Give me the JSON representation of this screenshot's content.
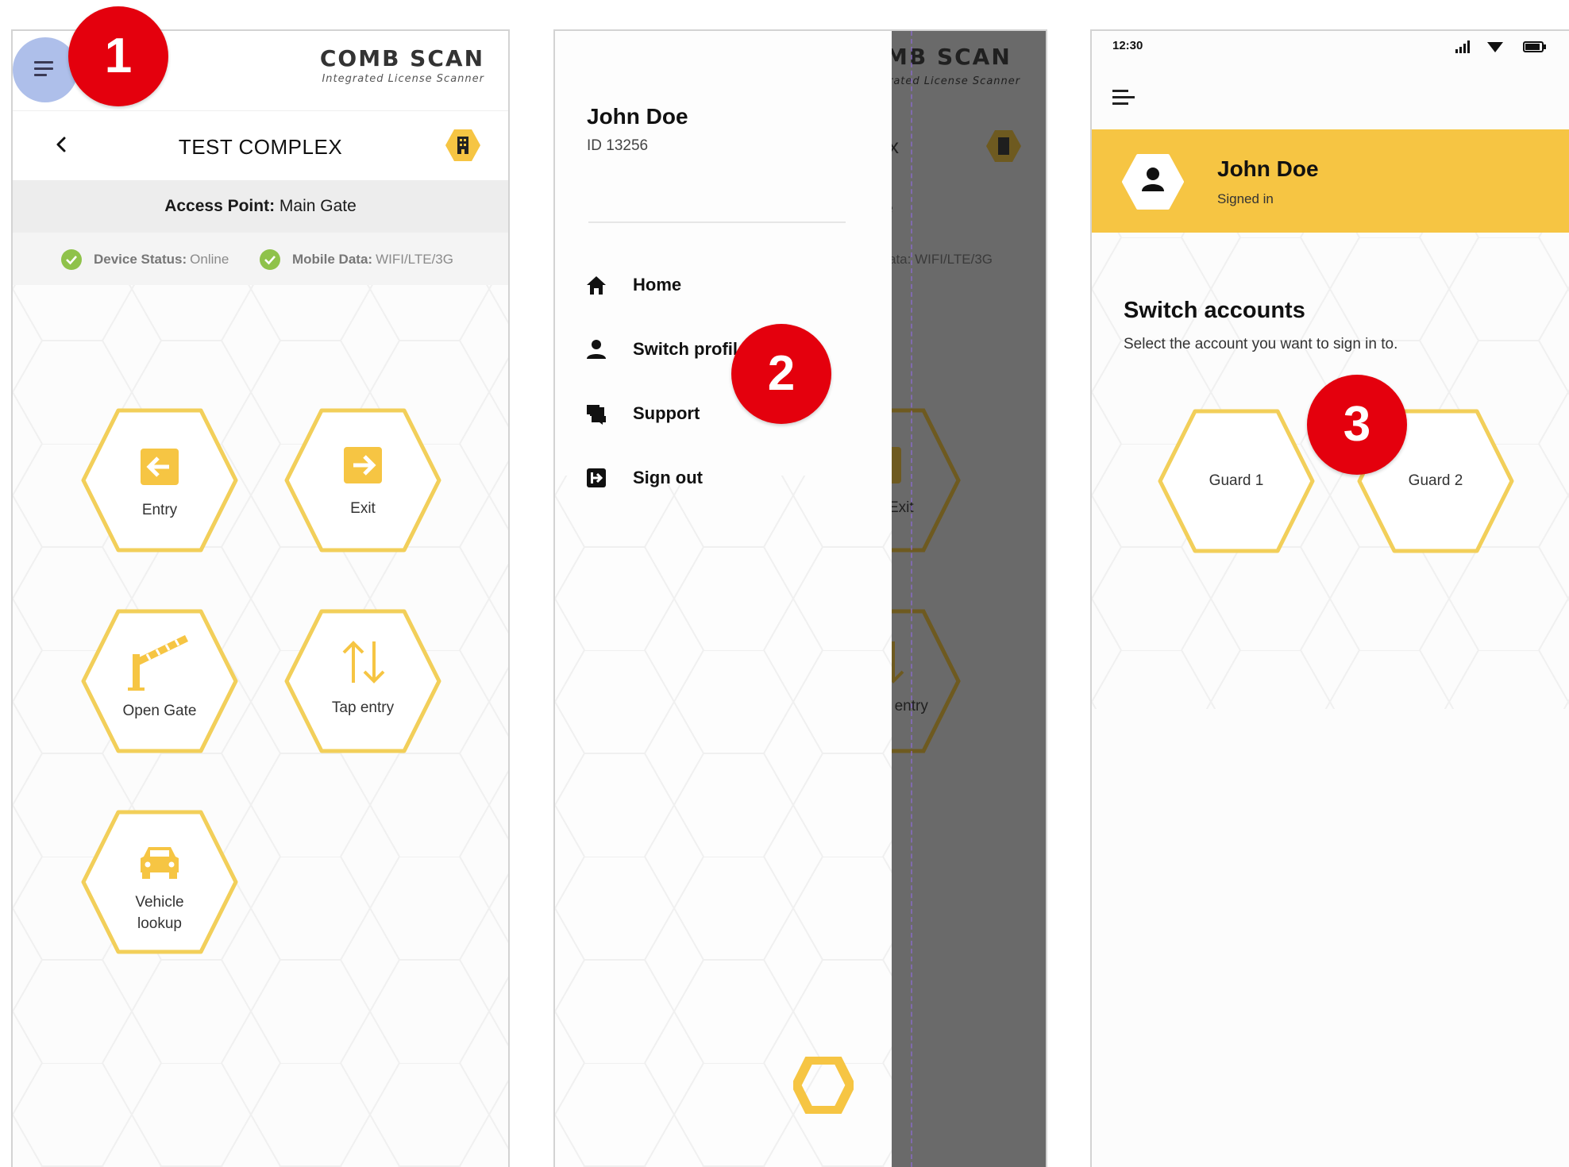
{
  "colors": {
    "accent": "#f6c543",
    "hex_outline": "#f2cf5a",
    "menu_highlight": "#aebfea",
    "marker": "#e4000d",
    "status_ok": "#8fc24a",
    "overlay": "#6a6a6a"
  },
  "logo": {
    "title": "COMB SCAN",
    "subtitle": "Integrated License Scanner"
  },
  "screen1": {
    "menu_icon": "hamburger-icon",
    "title": "TEST COMPLEX",
    "access_point": {
      "label": "Access Point:",
      "value": "Main Gate"
    },
    "status": [
      {
        "label": "Device Status:",
        "value": "Online",
        "icon": "check-circle-icon"
      },
      {
        "label": "Mobile Data:",
        "value": "WIFI/LTE/3G",
        "icon": "check-circle-icon"
      }
    ],
    "actions": [
      {
        "label": "Entry",
        "icon": "entry-arrow-icon"
      },
      {
        "label": "Exit",
        "icon": "exit-arrow-icon"
      },
      {
        "label": "Open Gate",
        "icon": "gate-barrier-icon"
      },
      {
        "label": "Tap entry",
        "icon": "swap-arrows-icon"
      },
      {
        "label_line1": "Vehicle",
        "label_line2": "lookup",
        "icon": "car-icon"
      }
    ]
  },
  "screen2": {
    "user_name": "John Doe",
    "user_id": "ID 13256",
    "menu": [
      {
        "label": "Home",
        "icon": "home-icon"
      },
      {
        "label": "Switch profil",
        "icon": "person-icon"
      },
      {
        "label": "Support",
        "icon": "chat-icon"
      },
      {
        "label": "Sign out",
        "icon": "sign-out-icon"
      }
    ],
    "background": {
      "logo_fragment": "MB SCAN",
      "subtitle_fragment": "rated License Scanner",
      "title_fragment": "x",
      "status_fragment": "ata: WIFI/LTE/3G",
      "exit_fragment": "Exit",
      "tap_fragment": "entry",
      "e_fragment": "e"
    }
  },
  "screen3": {
    "time": "12:30",
    "user_name": "John Doe",
    "user_status": "Signed in",
    "heading": "Switch accounts",
    "subheading": "Select the account you want to sign in to.",
    "accounts": [
      "Guard 1",
      "Guard 2"
    ]
  },
  "markers": [
    "1",
    "2",
    "3"
  ]
}
